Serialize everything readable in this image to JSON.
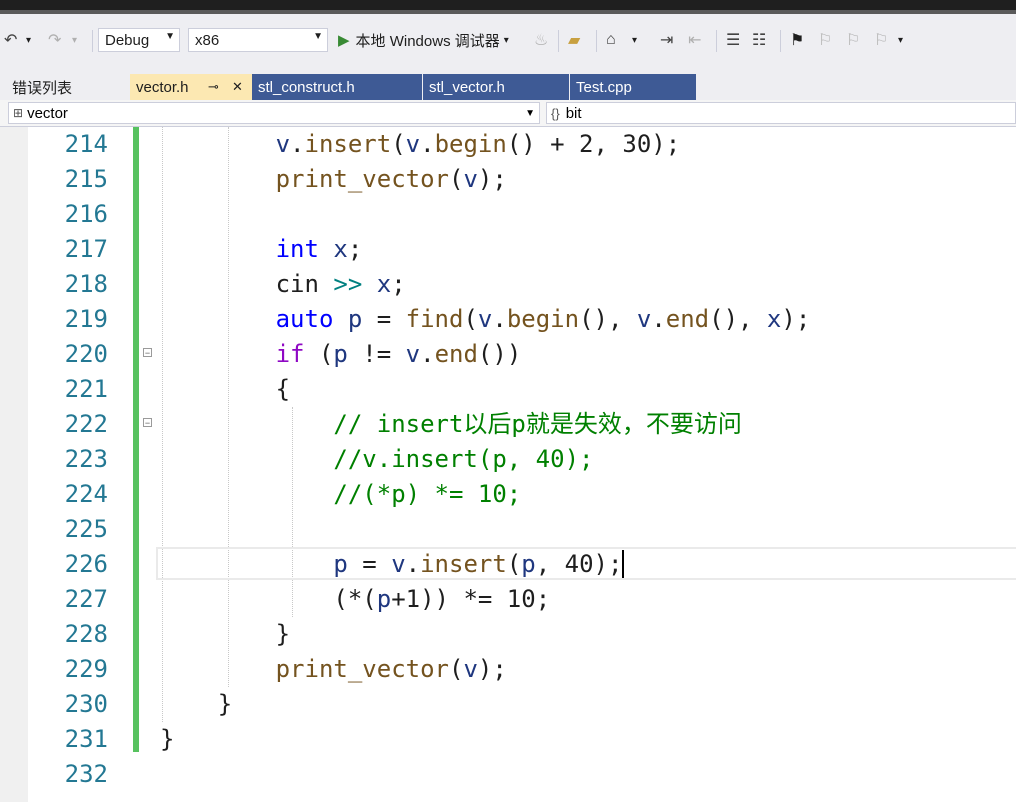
{
  "toolbar": {
    "config": "Debug",
    "platform": "x86",
    "run_label": "本地 Windows 调试器"
  },
  "tabs": [
    {
      "label": "错误列表"
    },
    {
      "label": "vector.h",
      "pin": "⊸",
      "close": "✕"
    },
    {
      "label": "stl_construct.h"
    },
    {
      "label": "stl_vector.h"
    },
    {
      "label": "Test.cpp"
    }
  ],
  "nav": {
    "scope": "vector",
    "member": "bit"
  },
  "code": {
    "line_numbers": [
      "214",
      "215",
      "216",
      "217",
      "218",
      "219",
      "220",
      "221",
      "222",
      "223",
      "224",
      "225",
      "226",
      "227",
      "228",
      "229",
      "230",
      "231",
      "232"
    ]
  }
}
